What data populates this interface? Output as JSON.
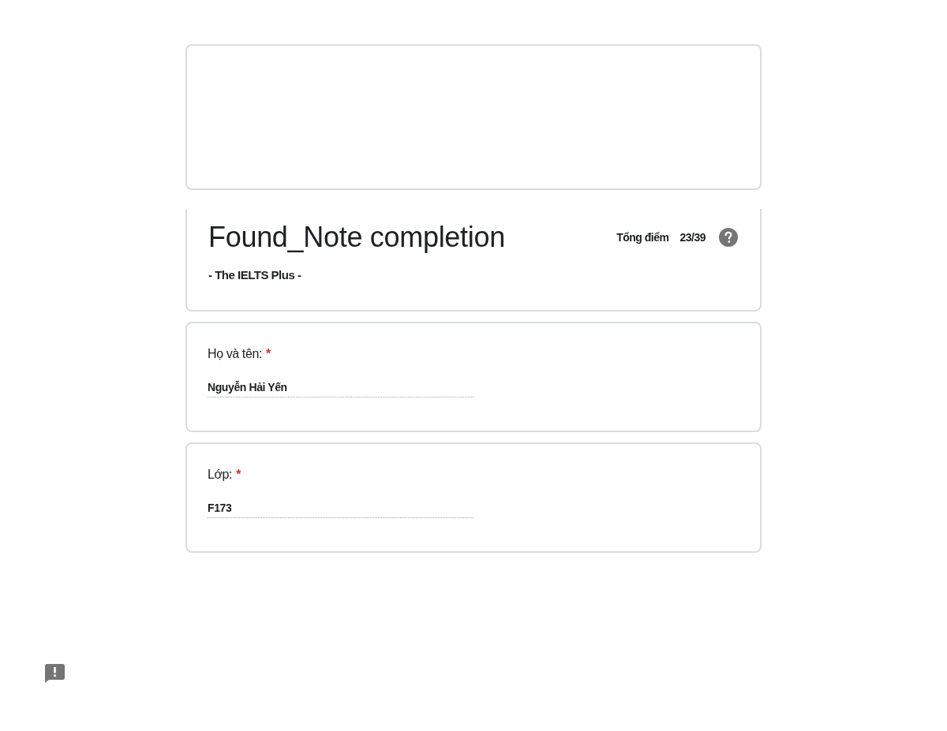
{
  "form": {
    "title": "Found_Note completion",
    "description": "- The IELTS Plus -",
    "score": {
      "label": "Tổng điểm",
      "value": "23/39"
    }
  },
  "questions": [
    {
      "label": "Họ và tên:",
      "required_mark": "*",
      "answer": "Nguyễn Hải Yến"
    },
    {
      "label": "Lớp:",
      "required_mark": "*",
      "answer": "F173"
    }
  ]
}
